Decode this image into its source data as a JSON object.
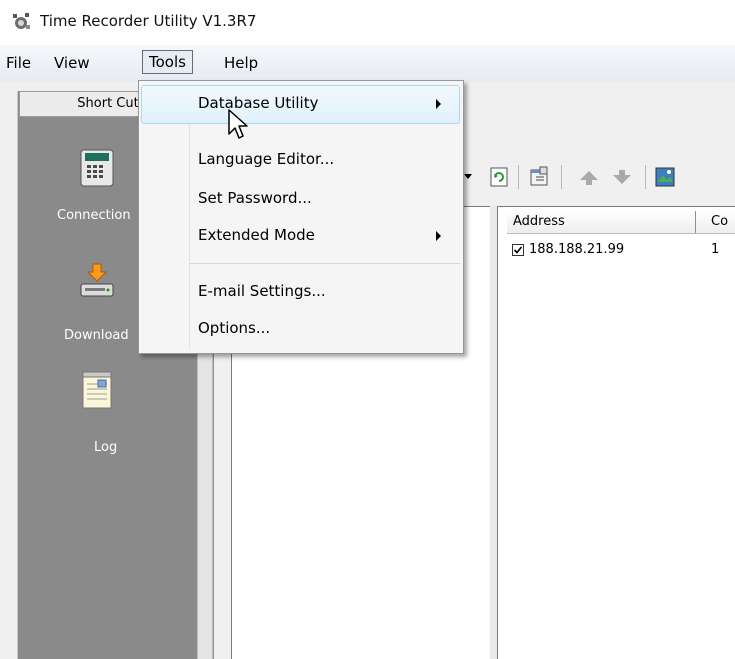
{
  "window": {
    "title": "Time Recorder Utility V1.3R7",
    "app_icon": "clock-gear-icon"
  },
  "menubar": {
    "items": [
      {
        "label": "File"
      },
      {
        "label": "View"
      },
      {
        "label": "Tools"
      },
      {
        "label": "Help"
      }
    ]
  },
  "shortcut_bar": {
    "tab_label": "Short Cut",
    "items": [
      {
        "label": "Connection",
        "icon": "terminal-device-icon"
      },
      {
        "label": "Download",
        "icon": "download-drive-icon"
      },
      {
        "label": "Log",
        "icon": "log-notepad-icon"
      }
    ]
  },
  "toolbar": {
    "icons": [
      "refresh-icon",
      "properties-icon",
      "arrow-up-icon",
      "arrow-down-icon",
      "image-icon"
    ]
  },
  "device_list": {
    "columns": [
      "Address",
      "Co"
    ],
    "rows": [
      {
        "checked": true,
        "address": "188.188.21.99",
        "col2": "1"
      }
    ]
  },
  "tools_menu": {
    "items": [
      {
        "label": "Database Utility",
        "submenu": true
      },
      {
        "label": "Language Editor...",
        "submenu": false
      },
      {
        "label": "Set Password...",
        "submenu": false
      },
      {
        "label": "Extended Mode",
        "submenu": true
      },
      {
        "label": "E-mail Settings...",
        "submenu": false
      },
      {
        "label": "Options...",
        "submenu": false
      }
    ]
  },
  "colors": {
    "shortcut_panel": "#8a8a8a",
    "menu_highlight": "#e1f1fb"
  }
}
